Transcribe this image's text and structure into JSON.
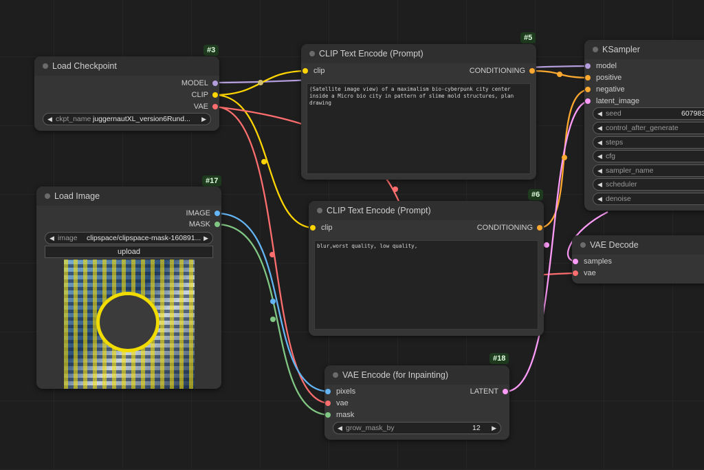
{
  "nodes": {
    "load_checkpoint": {
      "title": "Load Checkpoint",
      "id": "#3",
      "outputs": [
        "MODEL",
        "CLIP",
        "VAE"
      ],
      "widget": {
        "name": "ckpt_name",
        "value": "juggernautXL_version6Rund..."
      }
    },
    "load_image": {
      "title": "Load Image",
      "id": "#17",
      "outputs": [
        "IMAGE",
        "MASK"
      ],
      "widget": {
        "name": "image",
        "value": "clipspace/clipspace-mask-160891..."
      },
      "upload_label": "upload"
    },
    "clip_positive": {
      "title": "CLIP Text Encode (Prompt)",
      "id": "#5",
      "input": "clip",
      "output": "CONDITIONING",
      "text": "(Satellite image view) of a maximalism bio-cyberpunk city center inside a Micro bio city in pattern of slime mold structures, plan drawing"
    },
    "clip_negative": {
      "title": "CLIP Text Encode (Prompt)",
      "id": "#6",
      "input": "clip",
      "output": "CONDITIONING",
      "text": "blur,worst quality, low quality,"
    },
    "ksampler": {
      "title": "KSampler",
      "inputs": [
        "model",
        "positive",
        "negative",
        "latent_image"
      ],
      "widgets": [
        {
          "name": "seed",
          "value": "607983"
        },
        {
          "name": "control_after_generate",
          "value": ""
        },
        {
          "name": "steps",
          "value": ""
        },
        {
          "name": "cfg",
          "value": ""
        },
        {
          "name": "sampler_name",
          "value": ""
        },
        {
          "name": "scheduler",
          "value": ""
        },
        {
          "name": "denoise",
          "value": ""
        }
      ]
    },
    "vae_decode": {
      "title": "VAE Decode",
      "inputs": [
        "samples",
        "vae"
      ]
    },
    "vae_encode": {
      "title": "VAE Encode (for Inpainting)",
      "id": "#18",
      "inputs": [
        "pixels",
        "vae",
        "mask"
      ],
      "output": "LATENT",
      "widget": {
        "name": "grow_mask_by",
        "value": "12"
      }
    }
  },
  "colors": {
    "model": "#b39ddb",
    "clip": "#ffd500",
    "vae": "#ff6e6e",
    "conditioning": "#ffa931",
    "latent": "#ff9cf9",
    "image": "#64b5f6",
    "mask": "#81c784"
  },
  "icons": {
    "arrow_left": "◀",
    "arrow_right": "▶"
  }
}
